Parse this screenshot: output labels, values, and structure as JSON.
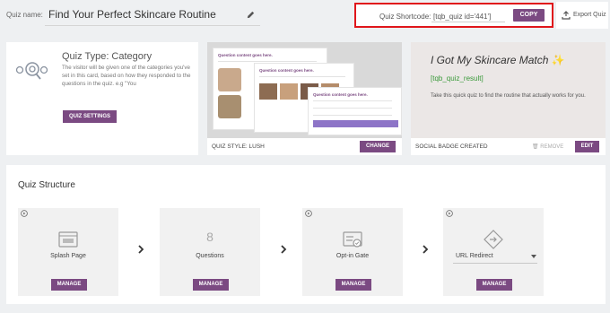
{
  "quiz_name": {
    "label": "Quiz name:",
    "value": "Find Your Perfect Skincare Routine",
    "edit_icon": "pencil-icon"
  },
  "shortcode": {
    "label": "Quiz Shortcode:",
    "value": "[tqb_quiz id='441']",
    "copy_label": "COPY"
  },
  "export": {
    "icon": "export-icon",
    "label": "Export Quiz"
  },
  "quiz_type": {
    "icon": "settings-target-icon",
    "title": "Quiz Type: Category",
    "description": "The visitor will be given one of the categories you've set in this card, based on how they responded to the questions in the quiz. e.g \"You",
    "button_label": "QUIZ SETTINGS"
  },
  "quiz_style": {
    "preview_titles": [
      "Question content goes here.",
      "Question content goes here.",
      "Question content goes here."
    ],
    "label": "QUIZ STYLE: LUSH",
    "button_label": "CHANGE"
  },
  "social_badge": {
    "title": "I Got My Skincare Match",
    "title_icon": "sparkle-icon",
    "variable": "[tqb_quiz_result]",
    "text": "Take this quick quiz to find the routine that actually works for you.",
    "status_label": "SOCIAL BADGE CREATED",
    "remove_label": "REMOVE",
    "remove_icon": "trash-icon",
    "edit_label": "EDIT"
  },
  "structure": {
    "title": "Quiz Structure",
    "steps": [
      {
        "icon": "splash-page-icon",
        "label": "Splash Page",
        "manage_label": "MANAGE"
      },
      {
        "count": "8",
        "label": "Questions",
        "manage_label": "MANAGE"
      },
      {
        "icon": "optin-gate-icon",
        "label": "Opt-in Gate",
        "manage_label": "MANAGE"
      },
      {
        "icon": "redirect-icon",
        "select_value": "URL Redirect",
        "manage_label": "MANAGE"
      }
    ]
  },
  "colors": {
    "accent": "#7b4a82",
    "highlight": "#e0161b",
    "variable_green": "#3a9a3a"
  }
}
